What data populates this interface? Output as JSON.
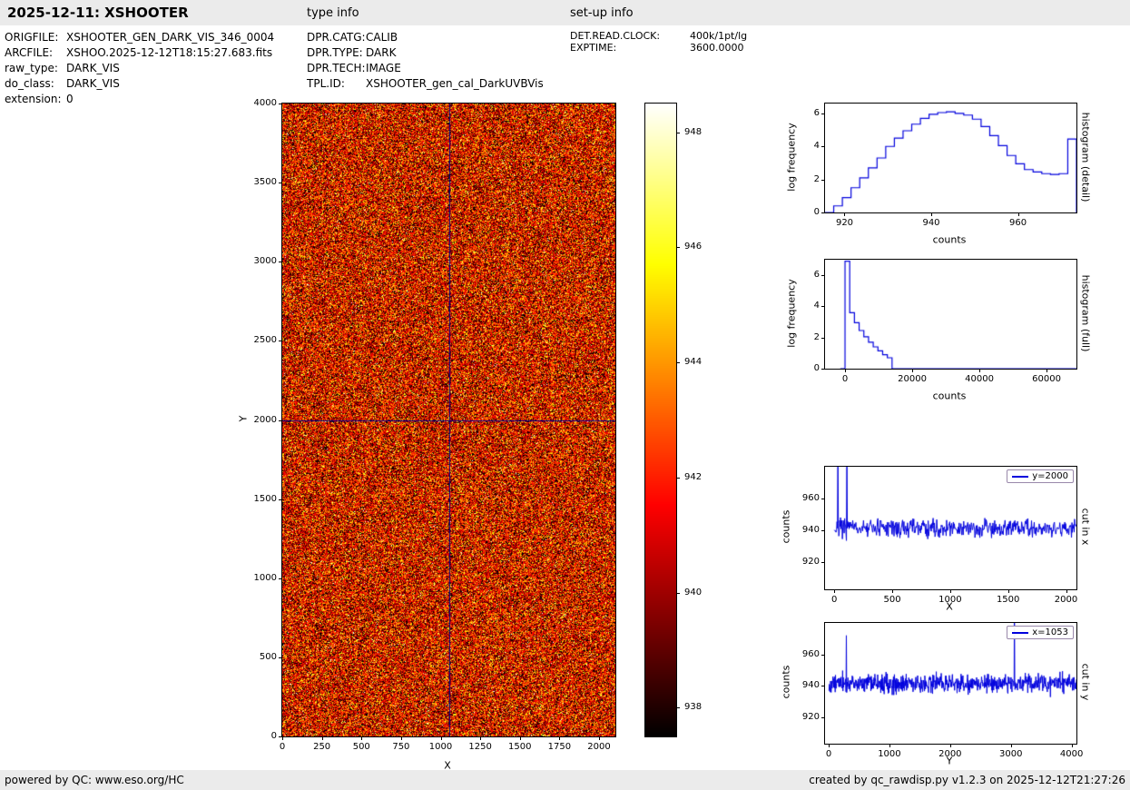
{
  "header": {
    "title": "2025-12-11: XSHOOTER"
  },
  "file_info": {
    "rows": [
      {
        "label": "ORIGFILE:",
        "value": "XSHOOTER_GEN_DARK_VIS_346_0004"
      },
      {
        "label": "ARCFILE:",
        "value": "XSHOO.2025-12-12T18:15:27.683.fits"
      },
      {
        "label": "raw_type:",
        "value": "DARK_VIS"
      },
      {
        "label": "do_class:",
        "value": "DARK_VIS"
      },
      {
        "label": "extension:",
        "value": "0"
      }
    ]
  },
  "type_info": {
    "heading": "type info",
    "rows": [
      {
        "label": "DPR.CATG:",
        "value": "CALIB"
      },
      {
        "label": "DPR.TYPE:",
        "value": "DARK"
      },
      {
        "label": "DPR.TECH:",
        "value": "IMAGE"
      },
      {
        "label": "TPL.ID:",
        "value": "XSHOOTER_gen_cal_DarkUVBVis"
      }
    ]
  },
  "setup_info": {
    "heading": "set-up info",
    "rows": [
      {
        "label": "DET.READ.CLOCK:",
        "value": "400k/1pt/lg"
      },
      {
        "label": "EXPTIME:",
        "value": "3600.0000"
      }
    ]
  },
  "footer": {
    "left": "powered by QC: www.eso.org/HC",
    "right": "created by qc_rawdisp.py v1.2.3 on 2025-12-12T21:27:26"
  },
  "chart_data": [
    {
      "id": "raw-image",
      "type": "heatmap",
      "description": "raw dark frame: uniform random noise around 941 counts, hot colormap",
      "xlabel": "X",
      "ylabel": "Y",
      "xlim": [
        0,
        2103
      ],
      "ylim": [
        0,
        4000
      ],
      "xticks": [
        0,
        250,
        500,
        750,
        1000,
        1250,
        1500,
        1750,
        2000
      ],
      "yticks": [
        0,
        500,
        1000,
        1500,
        2000,
        2500,
        3000,
        3500,
        4000
      ],
      "colormap": "hot",
      "vmin": 937.5,
      "vmax": 948.5,
      "colorbar_ticks": [
        938,
        940,
        942,
        944,
        946,
        948
      ],
      "crosshair": {
        "x": 1053,
        "y": 2000,
        "color": "#00008b"
      },
      "noise": {
        "mean": 941.3,
        "sigma": 2.5,
        "seed": 42
      }
    },
    {
      "id": "hist-detail",
      "type": "line",
      "style": "step",
      "right_label": "histogram (detail)",
      "xlabel": "counts",
      "ylabel": "log frequency",
      "xlim": [
        915.5,
        973.5
      ],
      "ylim": [
        0,
        6.6
      ],
      "xticks": [
        920,
        940,
        960
      ],
      "yticks": [
        0,
        2,
        4,
        6
      ],
      "color": "#0000dd",
      "edges": [
        915.5,
        917.5,
        919.5,
        921.5,
        923.5,
        925.5,
        927.5,
        929.5,
        931.5,
        933.5,
        935.5,
        937.5,
        939.5,
        941.5,
        943.5,
        945.5,
        947.5,
        949.5,
        951.5,
        953.5,
        955.5,
        957.5,
        959.5,
        961.5,
        963.5,
        965.5,
        967.5,
        969.5,
        971.5,
        973.5
      ],
      "levels": [
        0.0,
        0.4,
        0.9,
        1.5,
        2.1,
        2.7,
        3.3,
        4.0,
        4.5,
        4.95,
        5.35,
        5.7,
        5.95,
        6.05,
        6.1,
        6.0,
        5.9,
        5.65,
        5.2,
        4.65,
        4.05,
        3.45,
        2.95,
        2.6,
        2.45,
        2.35,
        2.3,
        2.35,
        4.45
      ]
    },
    {
      "id": "hist-full",
      "type": "line",
      "style": "step",
      "right_label": "histogram (full)",
      "xlabel": "counts",
      "ylabel": "log frequency",
      "xlim": [
        -5950,
        68900
      ],
      "ylim": [
        0,
        7.0
      ],
      "xticks": [
        0,
        20000,
        40000,
        60000
      ],
      "yticks": [
        0,
        2,
        4,
        6
      ],
      "color": "#0000dd",
      "edges": [
        -1400,
        0,
        1400,
        2800,
        4200,
        5600,
        7000,
        8400,
        9800,
        11200,
        12600,
        14000,
        68900
      ],
      "levels": [
        0.0,
        6.9,
        3.6,
        2.95,
        2.45,
        2.05,
        1.7,
        1.4,
        1.15,
        0.9,
        0.7,
        0.0
      ]
    },
    {
      "id": "cut-x",
      "type": "line",
      "legend": "y=2000",
      "right_label": "cut in x",
      "xlabel": "X",
      "ylabel": "counts",
      "xlim": [
        -80,
        2090
      ],
      "ylim": [
        903,
        980
      ],
      "xticks": [
        0,
        500,
        1000,
        1500,
        2000
      ],
      "yticks": [
        920,
        940,
        960
      ],
      "color": "#0000dd",
      "noise": {
        "mean": 941.5,
        "sigma": 2.8,
        "seed": 7,
        "n": 540,
        "x0": 0,
        "x1": 2090
      },
      "spikes": [
        {
          "x": 30,
          "v": 995
        },
        {
          "x": 110,
          "v": 995
        }
      ]
    },
    {
      "id": "cut-y",
      "type": "line",
      "legend": "x=1053",
      "right_label": "cut in y",
      "xlabel": "Y",
      "ylabel": "counts",
      "xlim": [
        -60,
        4080
      ],
      "ylim": [
        903,
        980
      ],
      "xticks": [
        0,
        1000,
        2000,
        3000,
        4000
      ],
      "yticks": [
        920,
        940,
        960
      ],
      "color": "#0000dd",
      "noise": {
        "mean": 941.5,
        "sigma": 2.8,
        "seed": 13,
        "n": 800,
        "x0": 0,
        "x1": 4080
      },
      "spikes": [
        {
          "x": 290,
          "v": 972
        },
        {
          "x": 3060,
          "v": 995
        }
      ]
    }
  ]
}
